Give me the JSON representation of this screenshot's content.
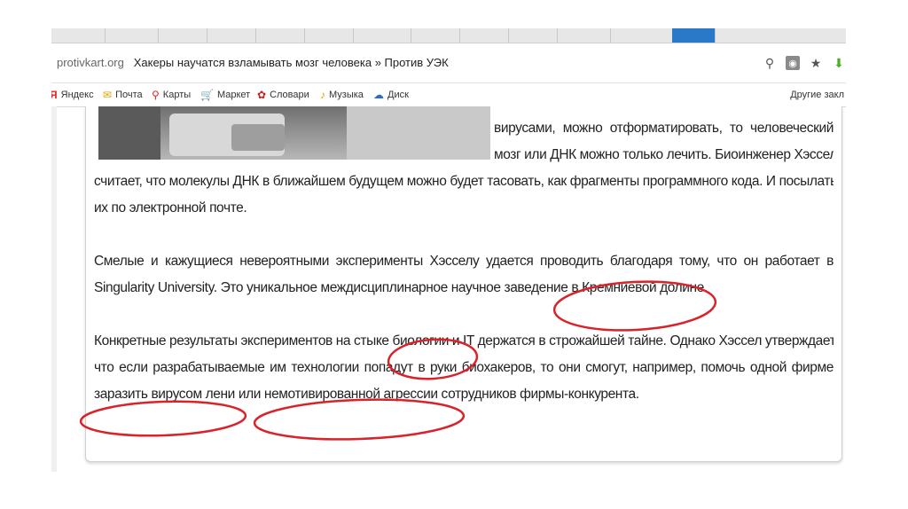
{
  "browser": {
    "url_domain": "protivkart.org",
    "page_title": "Хакеры научатся взламывать мозг человека » Против УЭК",
    "accent": "#2a79c8"
  },
  "bookmarks": [
    {
      "icon": "yandex-icon",
      "label": "Яндекс"
    },
    {
      "icon": "mail-icon",
      "label": "Почта"
    },
    {
      "icon": "maps-icon",
      "label": "Карты"
    },
    {
      "icon": "market-icon",
      "label": "Маркет"
    },
    {
      "icon": "dictionary-icon",
      "label": "Словари"
    },
    {
      "icon": "music-icon",
      "label": "Музыка"
    },
    {
      "icon": "disk-icon",
      "label": "Диск"
    }
  ],
  "other_bookmarks": "Другие закл",
  "article": {
    "lines_top": [
      "вирусами, можно отформатировать, то человеческий",
      "мозг или ДНК можно только лечить. Биоинженер Хэссел"
    ],
    "para1": [
      "считает, что молекулы ДНК в ближайшем будущем можно будет тасовать, как фрагменты программного кода. И посылать",
      "их по электронной почте."
    ],
    "para2": [
      "Смелые и кажущиеся невероятными эксперименты Хэсселу удается проводить благодаря тому, что он работает в",
      "Singularity University. Это уникальное междисциплинарное научное заведение в Кремниевой долине."
    ],
    "para3": [
      "Конкретные результаты экспериментов на стыке биологии и IT держатся в строжайшей тайне. Однако Хэссел утверждает,",
      "что если разрабатываемые им технологии попадут в руки биохакеров, то они смогут, например, помочь одной фирме",
      "заразить вирусом лени или немотивированной агрессии сотрудников фирмы-конкурента."
    ]
  },
  "annotation_color": "#d8232a"
}
